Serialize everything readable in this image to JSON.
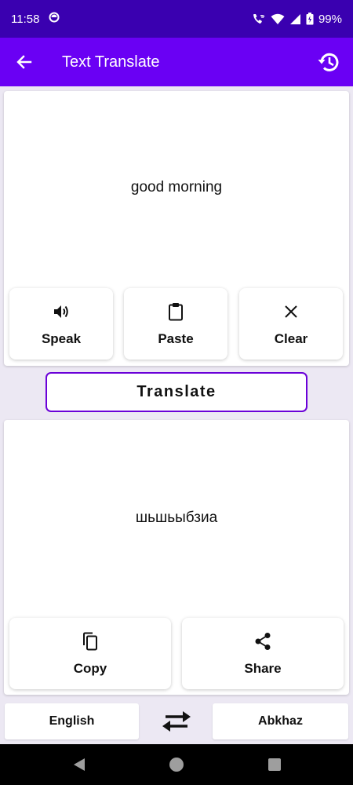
{
  "status_bar": {
    "time": "11:58",
    "battery": "99%"
  },
  "app_bar": {
    "title": "Text Translate",
    "back_icon": "arrow-back-icon",
    "history_icon": "history-icon"
  },
  "input": {
    "text": "good morning",
    "actions": [
      {
        "label": "Speak",
        "icon": "speaker-icon"
      },
      {
        "label": "Paste",
        "icon": "clipboard-icon"
      },
      {
        "label": "Clear",
        "icon": "close-icon"
      }
    ]
  },
  "translate_button": {
    "label": "Translate"
  },
  "output": {
    "text": "шьшьыбзиа",
    "actions": [
      {
        "label": "Copy",
        "icon": "copy-icon"
      },
      {
        "label": "Share",
        "icon": "share-icon"
      }
    ]
  },
  "languages": {
    "source": "English",
    "target": "Abkhaz",
    "swap_icon": "swap-arrows-icon"
  },
  "colors": {
    "status_bar": "#3a00b0",
    "app_bar": "#6a00f4",
    "accent_border": "#6a00d8",
    "background": "#ece8f3"
  }
}
